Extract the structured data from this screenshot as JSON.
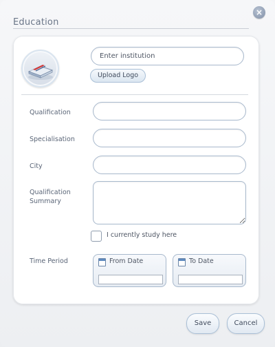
{
  "dialog": {
    "title": "Education",
    "close_icon": "close-icon"
  },
  "institution": {
    "placeholder": "Enter institution",
    "value": "",
    "upload_label": "Upload Logo",
    "logo_icon": "book-icon"
  },
  "fields": {
    "qualification_label": "Qualification",
    "qualification_value": "",
    "specialisation_label": "Specialisation",
    "specialisation_value": "",
    "city_label": "City",
    "city_value": "",
    "summary_label_line1": "Qualification",
    "summary_label_line2": "Summary",
    "summary_value": ""
  },
  "current_study": {
    "label": "I currently study here",
    "checked": false
  },
  "time_period": {
    "label": "Time Period",
    "from_label": "From Date",
    "from_value": "",
    "to_label": "To Date",
    "to_value": "",
    "calendar_icon": "calendar-icon"
  },
  "actions": {
    "save_label": "Save",
    "cancel_label": "Cancel"
  }
}
